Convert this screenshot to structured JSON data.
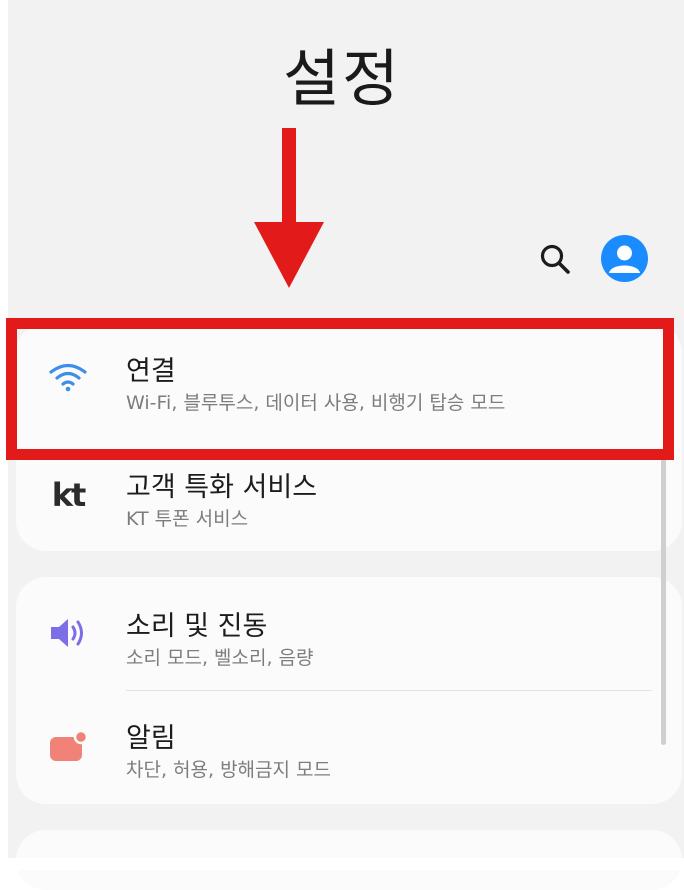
{
  "header": {
    "title": "설정"
  },
  "toolbar": {
    "search_icon": "search-icon",
    "account_icon": "account-icon"
  },
  "groups": [
    {
      "items": [
        {
          "id": "connections",
          "icon": "wifi-icon",
          "title": "연결",
          "subtitle": "Wi-Fi, 블루투스, 데이터 사용, 비행기 탑승 모드",
          "highlighted": true
        },
        {
          "id": "kt-services",
          "icon": "kt-logo-icon",
          "icon_text": "kt",
          "title": "고객 특화 서비스",
          "subtitle": "KT 투폰 서비스"
        }
      ]
    },
    {
      "items": [
        {
          "id": "sounds",
          "icon": "speaker-icon",
          "title": "소리 및 진동",
          "subtitle": "소리 모드, 벨소리, 음량"
        },
        {
          "id": "notifications",
          "icon": "notification-icon",
          "title": "알림",
          "subtitle": "차단, 허용, 방해금지 모드"
        }
      ]
    }
  ],
  "annotation": {
    "arrow_color": "#e31a1a",
    "highlight_color": "#e31a1a"
  },
  "colors": {
    "wifi": "#3d8ee8",
    "speaker": "#7b6ee6",
    "notification": "#f08277",
    "account": "#1a8cff"
  }
}
